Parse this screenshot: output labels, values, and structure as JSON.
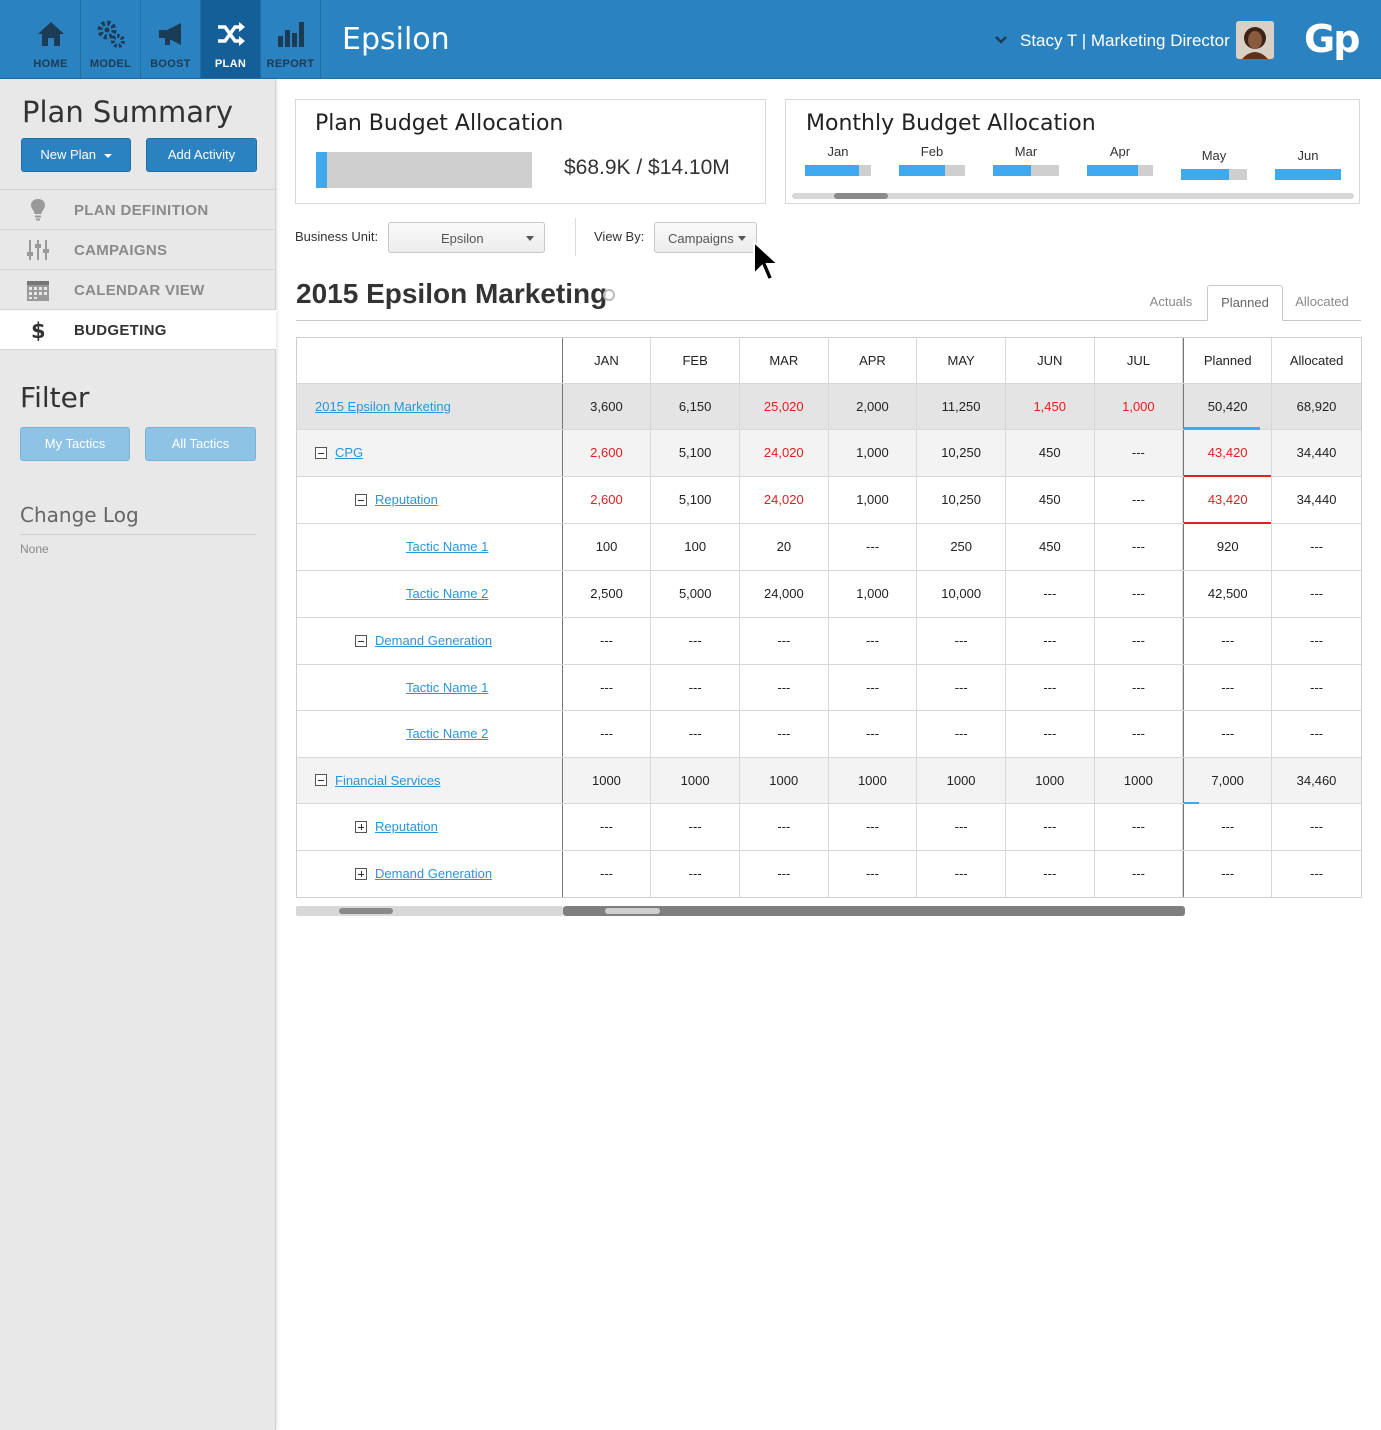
{
  "nav": {
    "items": [
      {
        "label": "HOME",
        "icon": "home-icon"
      },
      {
        "label": "MODEL",
        "icon": "gears-icon"
      },
      {
        "label": "BOOST",
        "icon": "megaphone-icon"
      },
      {
        "label": "PLAN",
        "icon": "shuffle-icon",
        "active": true
      },
      {
        "label": "REPORT",
        "icon": "bar-chart-icon"
      }
    ],
    "app_title": "Epsilon",
    "user": "Stacy T  |  Marketing Director",
    "logo": "Gp"
  },
  "sidebar": {
    "title": "Plan Summary",
    "new_plan_label": "New Plan",
    "add_activity_label": "Add Activity",
    "items": [
      {
        "label": "PLAN DEFINITION",
        "icon": "lightbulb-icon"
      },
      {
        "label": "CAMPAIGNS",
        "icon": "sliders-icon"
      },
      {
        "label": "CALENDAR VIEW",
        "icon": "calendar-icon"
      },
      {
        "label": "BUDGETING",
        "icon": "dollar-icon",
        "active": true
      }
    ],
    "filter_title": "Filter",
    "my_tactics_label": "My Tactics",
    "all_tactics_label": "All Tactics",
    "changelog_title": "Change Log",
    "changelog_value": "None"
  },
  "plan_budget": {
    "title": "Plan Budget Allocation",
    "value_text": "$68.9K / $14.10M",
    "fill_fraction": 0.05
  },
  "monthly_budget": {
    "title": "Monthly Budget Allocation",
    "months": [
      {
        "label": "Jan",
        "fill": 0.82
      },
      {
        "label": "Feb",
        "fill": 0.7
      },
      {
        "label": "Mar",
        "fill": 0.58
      },
      {
        "label": "Apr",
        "fill": 0.78
      },
      {
        "label": "May",
        "fill": 0.72
      },
      {
        "label": "Jun",
        "fill": 1.0
      }
    ]
  },
  "filters": {
    "business_unit_label": "Business Unit:",
    "business_unit_value": "Epsilon",
    "view_by_label": "View By:",
    "view_by_value": "Campaigns"
  },
  "section": {
    "title": "2015 Epsilon Marketing",
    "tabs": [
      "Actuals",
      "Planned",
      "Allocated"
    ],
    "active_tab": "Planned"
  },
  "colors": {
    "brand_blue": "#2a82c0",
    "accent_blue": "#3fa9ee",
    "alert_red": "#e02020"
  },
  "table": {
    "headers": [
      "JAN",
      "FEB",
      "MAR",
      "APR",
      "MAY",
      "JUN",
      "JUL",
      "Planned",
      "Allocated"
    ],
    "rows": [
      {
        "name": "2015 Epsilon Marketing",
        "level": 0,
        "toggle": "",
        "shade": "dark",
        "cells": [
          "3,600",
          "6,150",
          "25,020",
          "2,000",
          "11,250",
          "1,450",
          "1,000",
          "50,420",
          "68,920"
        ],
        "red": [
          2,
          5,
          6
        ],
        "planned_marker": "blue-long"
      },
      {
        "name": "CPG",
        "level": 0,
        "toggle": "minus",
        "shade": "light",
        "cells": [
          "2,600",
          "5,100",
          "24,020",
          "1,000",
          "10,250",
          "450",
          "---",
          "43,420",
          "34,440"
        ],
        "red": [
          0,
          2,
          7
        ],
        "planned_marker": "red"
      },
      {
        "name": "Reputation",
        "level": 1,
        "toggle": "minus",
        "shade": "",
        "cells": [
          "2,600",
          "5,100",
          "24,020",
          "1,000",
          "10,250",
          "450",
          "---",
          "43,420",
          "34,440"
        ],
        "red": [
          0,
          2,
          7
        ],
        "planned_marker": "red"
      },
      {
        "name": "Tactic Name 1",
        "level": 2,
        "toggle": "",
        "shade": "",
        "cells": [
          "100",
          "100",
          "20",
          "---",
          "250",
          "450",
          "---",
          "920",
          "---"
        ],
        "red": [],
        "planned_marker": ""
      },
      {
        "name": "Tactic Name 2",
        "level": 2,
        "toggle": "",
        "shade": "",
        "cells": [
          "2,500",
          "5,000",
          "24,000",
          "1,000",
          "10,000",
          "---",
          "---",
          "42,500",
          "---"
        ],
        "red": [],
        "planned_marker": ""
      },
      {
        "name": "Demand Generation",
        "level": 1,
        "toggle": "minus",
        "shade": "",
        "cells": [
          "---",
          "---",
          "---",
          "---",
          "---",
          "---",
          "---",
          "---",
          "---"
        ],
        "red": [],
        "planned_marker": ""
      },
      {
        "name": "Tactic Name 1",
        "level": 2,
        "toggle": "",
        "shade": "",
        "cells": [
          "---",
          "---",
          "---",
          "---",
          "---",
          "---",
          "---",
          "---",
          "---"
        ],
        "red": [],
        "planned_marker": ""
      },
      {
        "name": "Tactic Name 2",
        "level": 2,
        "toggle": "",
        "shade": "",
        "cells": [
          "---",
          "---",
          "---",
          "---",
          "---",
          "---",
          "---",
          "---",
          "---"
        ],
        "red": [],
        "planned_marker": ""
      },
      {
        "name": "Financial Services",
        "level": 0,
        "toggle": "minus",
        "shade": "light",
        "cells": [
          "1000",
          "1000",
          "1000",
          "1000",
          "1000",
          "1000",
          "1000",
          "7,000",
          "34,460"
        ],
        "red": [],
        "planned_marker": "blue-short"
      },
      {
        "name": "Reputation",
        "level": 1,
        "toggle": "plus",
        "shade": "",
        "cells": [
          "---",
          "---",
          "---",
          "---",
          "---",
          "---",
          "---",
          "---",
          "---"
        ],
        "red": [],
        "planned_marker": ""
      },
      {
        "name": "Demand Generation",
        "level": 1,
        "toggle": "plus",
        "shade": "",
        "cells": [
          "---",
          "---",
          "---",
          "---",
          "---",
          "---",
          "---",
          "---",
          "---"
        ],
        "red": [],
        "planned_marker": ""
      }
    ]
  }
}
